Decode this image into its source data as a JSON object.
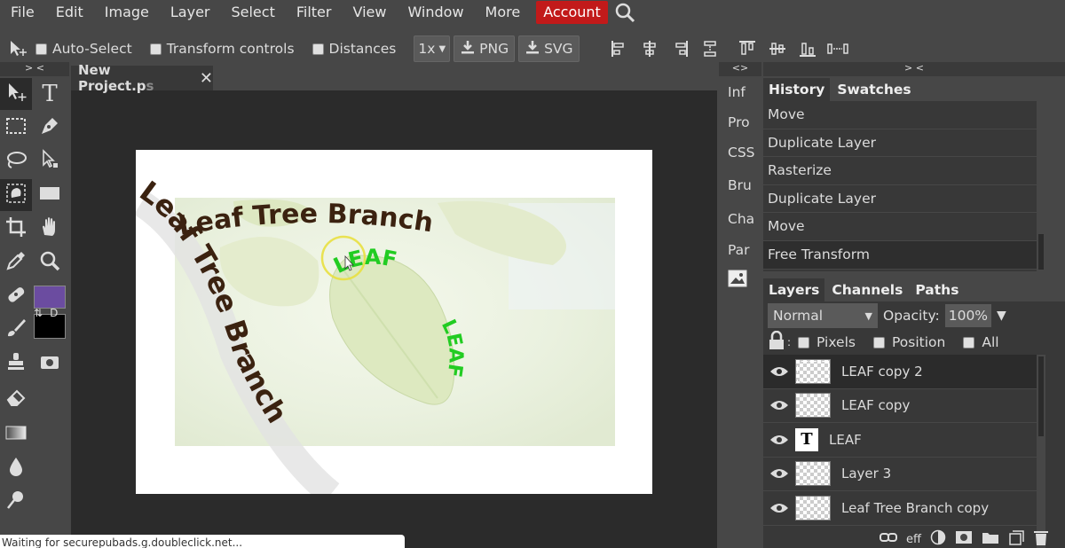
{
  "menubar": {
    "items": [
      "File",
      "Edit",
      "Image",
      "Layer",
      "Select",
      "Filter",
      "View",
      "Window",
      "More"
    ],
    "account_label": "Account"
  },
  "options": {
    "auto_select": "Auto-Select",
    "transform_controls": "Transform controls",
    "distances": "Distances",
    "scale_value": "1x",
    "png_label": "PNG",
    "svg_label": "SVG"
  },
  "panel_toggles": {
    "left": "> <",
    "mini": "<>",
    "right": "> <"
  },
  "document": {
    "tab_title": "New Project.p",
    "tab_title_fade": "s",
    "canvas_text_main_top": "Leaf Tree Branch",
    "canvas_text_main_curved": "Leaf Tree Branch",
    "canvas_text_leaf_top": "LEAF",
    "canvas_text_leaf_side": "LEAF"
  },
  "status_text": "Waiting for securepubads.g.doubleclick.net...",
  "mini_panels": [
    "Inf",
    "Pro",
    "CSS",
    "Bru",
    "Cha",
    "Par"
  ],
  "history_panel": {
    "tabs": [
      "History",
      "Swatches"
    ],
    "items": [
      "Move",
      "Duplicate Layer",
      "Rasterize",
      "Duplicate Layer",
      "Move",
      "Free Transform"
    ]
  },
  "layers_panel": {
    "tabs": [
      "Layers",
      "Channels",
      "Paths"
    ],
    "blend_mode": "Normal",
    "opacity_label": "Opacity:",
    "opacity_value": "100%",
    "lock_pixels": "Pixels",
    "lock_position": "Position",
    "lock_all": "All",
    "layers": [
      {
        "name": "LEAF copy 2",
        "kind": "raster",
        "selected": true
      },
      {
        "name": "LEAF copy",
        "kind": "raster",
        "selected": false
      },
      {
        "name": "LEAF",
        "kind": "text",
        "selected": false
      },
      {
        "name": "Layer 3",
        "kind": "raster",
        "selected": false
      },
      {
        "name": "Leaf Tree Branch copy",
        "kind": "raster",
        "selected": false
      }
    ],
    "footer_eff": "eff"
  },
  "colors": {
    "account_red": "#c21a1a",
    "foreground_color": "#6b4ca0",
    "background_color": "#000000",
    "leaf_text_green": "#22cc22",
    "branch_text_brown": "#3b2210"
  }
}
